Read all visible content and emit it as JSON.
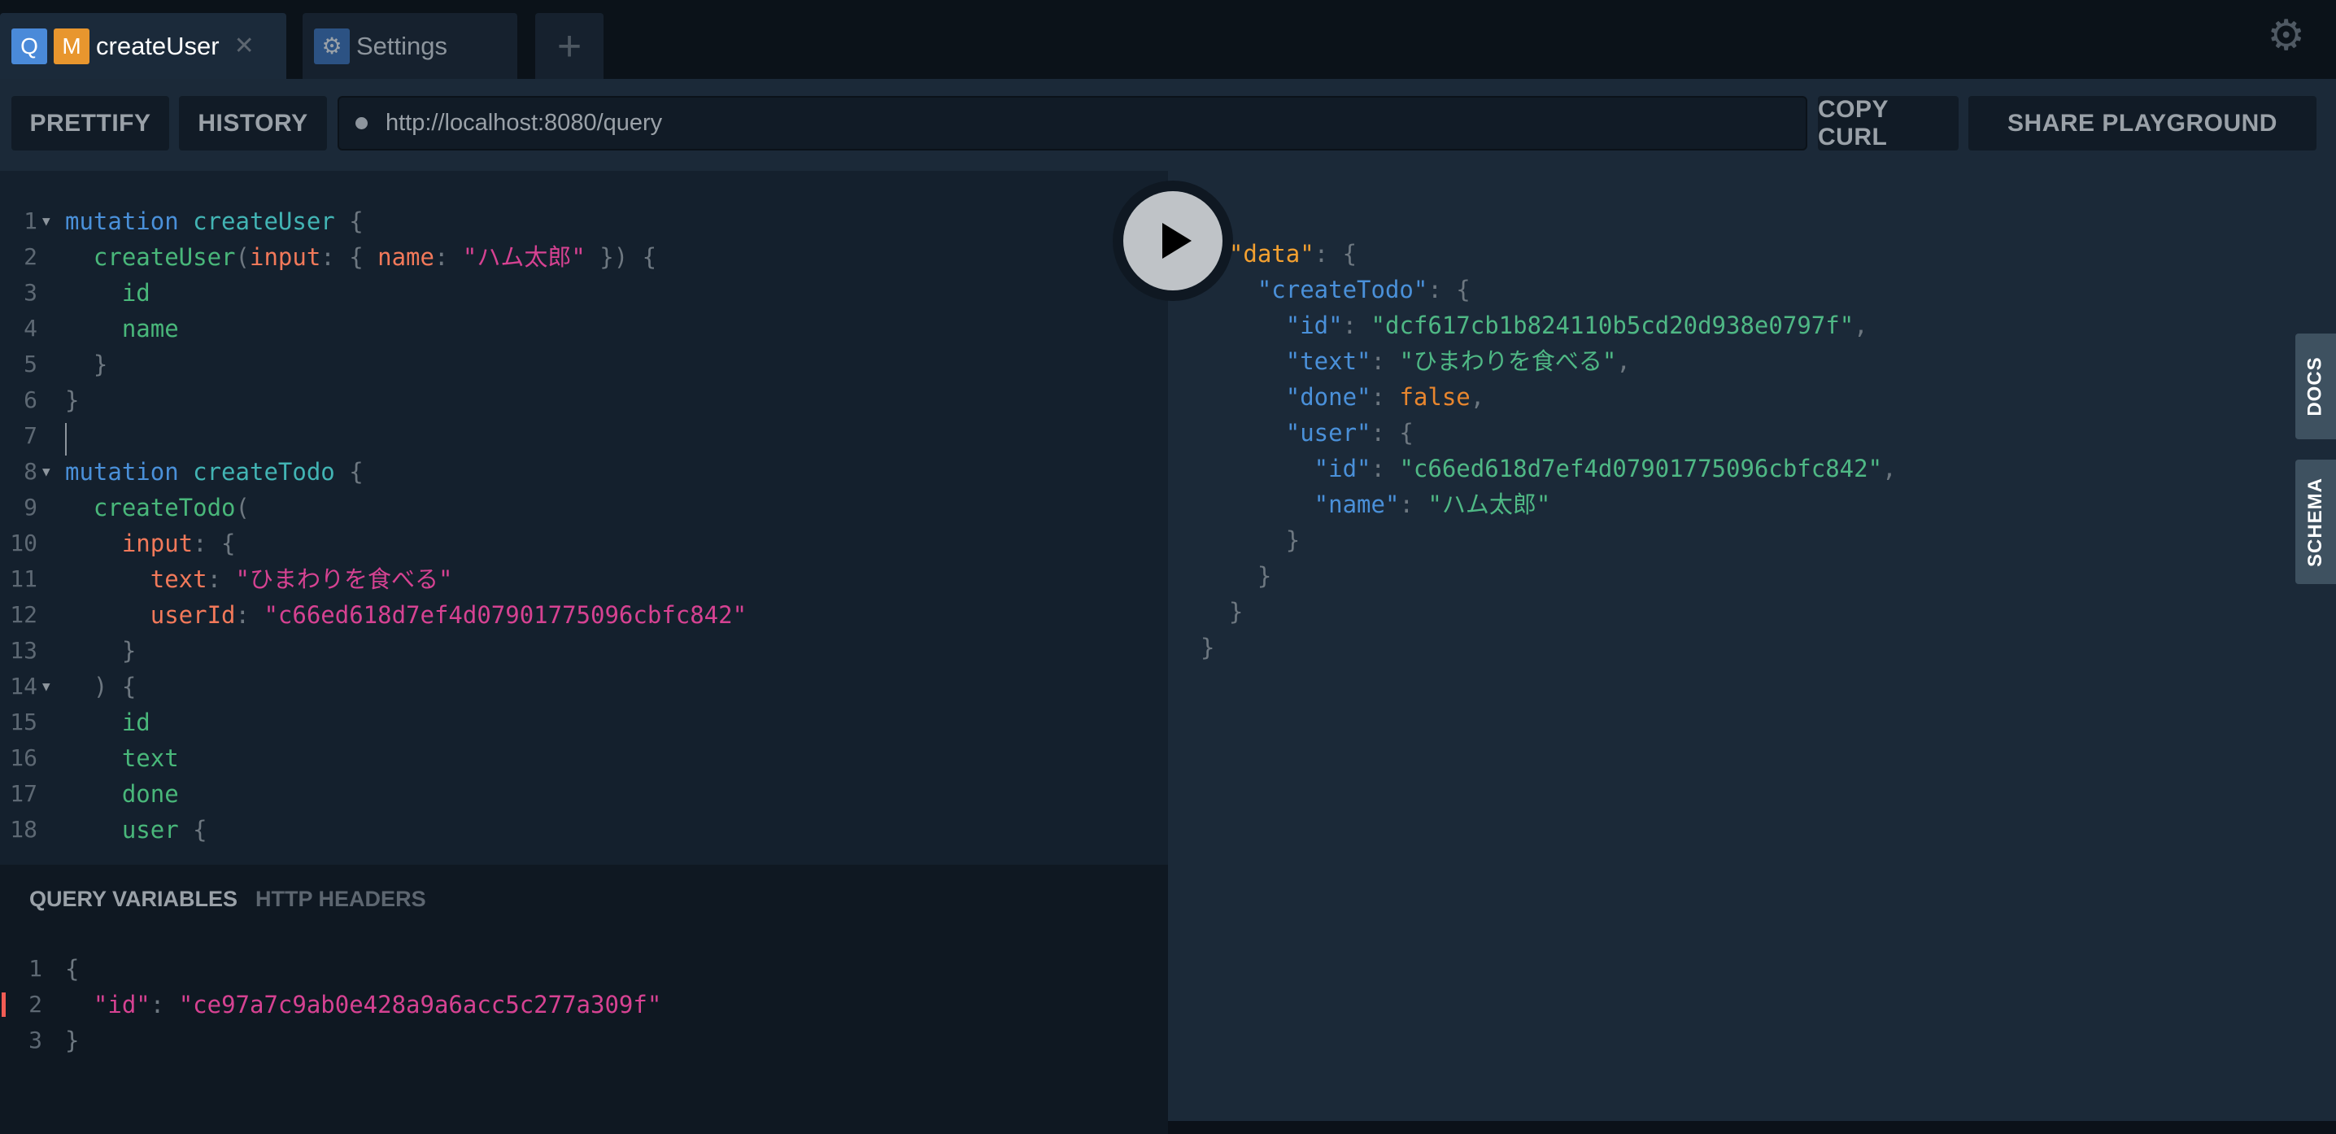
{
  "tabs": [
    {
      "label": "createUser",
      "badges": [
        "Q",
        "M"
      ],
      "active": true
    },
    {
      "label": "Settings",
      "icon": "gear-icon"
    },
    {
      "label": "+",
      "icon": "plus-icon"
    }
  ],
  "colors": {
    "query_badge": "#4a8ad9",
    "mutation_badge": "#e8962e",
    "settings_badge": "#2c5283",
    "accent_error": "#f25c54"
  },
  "toolbar": {
    "prettify": "PRETTIFY",
    "history": "HISTORY",
    "url": "http://localhost:8080/query",
    "copy_curl": "COPY CURL",
    "share": "SHARE PLAYGROUND"
  },
  "side_tabs": {
    "docs": "DOCS",
    "schema": "SCHEMA"
  },
  "bottom_tabs": {
    "variables": "QUERY VARIABLES",
    "headers": "HTTP HEADERS"
  },
  "editor_lines": [
    {
      "n": "1",
      "fold": true,
      "tokens": [
        [
          "keyword",
          "mutation "
        ],
        [
          "def",
          "createUser "
        ],
        [
          "punct",
          "{"
        ]
      ]
    },
    {
      "n": "2",
      "tokens": [
        [
          "field",
          "  createUser"
        ],
        [
          "punct",
          "("
        ],
        [
          "attr",
          "input"
        ],
        [
          "punct",
          ": { "
        ],
        [
          "attr",
          "name"
        ],
        [
          "punct",
          ": "
        ],
        [
          "string",
          "\"ハム太郎\""
        ],
        [
          "punct",
          " }) {"
        ]
      ]
    },
    {
      "n": "3",
      "tokens": [
        [
          "field",
          "    id"
        ]
      ]
    },
    {
      "n": "4",
      "tokens": [
        [
          "field",
          "    name"
        ]
      ]
    },
    {
      "n": "5",
      "tokens": [
        [
          "punct",
          "  }"
        ]
      ]
    },
    {
      "n": "6",
      "tokens": [
        [
          "punct",
          "}"
        ]
      ]
    },
    {
      "n": "7",
      "cursor": true,
      "tokens": []
    },
    {
      "n": "8",
      "fold": true,
      "tokens": [
        [
          "keyword",
          "mutation "
        ],
        [
          "def",
          "createTodo "
        ],
        [
          "punct",
          "{"
        ]
      ]
    },
    {
      "n": "9",
      "tokens": [
        [
          "field",
          "  createTodo"
        ],
        [
          "punct",
          "("
        ]
      ]
    },
    {
      "n": "10",
      "tokens": [
        [
          "attr",
          "    input"
        ],
        [
          "punct",
          ": {"
        ]
      ]
    },
    {
      "n": "11",
      "tokens": [
        [
          "attr",
          "      text"
        ],
        [
          "punct",
          ": "
        ],
        [
          "string",
          "\"ひまわりを食べる\""
        ]
      ]
    },
    {
      "n": "12",
      "tokens": [
        [
          "attr",
          "      userId"
        ],
        [
          "punct",
          ": "
        ],
        [
          "string",
          "\"c66ed618d7ef4d07901775096cbfc842\""
        ]
      ]
    },
    {
      "n": "13",
      "tokens": [
        [
          "punct",
          "    }"
        ]
      ]
    },
    {
      "n": "14",
      "fold": true,
      "tokens": [
        [
          "punct",
          "  ) {"
        ]
      ]
    },
    {
      "n": "15",
      "tokens": [
        [
          "field",
          "    id"
        ]
      ]
    },
    {
      "n": "16",
      "tokens": [
        [
          "field",
          "    text"
        ]
      ]
    },
    {
      "n": "17",
      "tokens": [
        [
          "field",
          "    done"
        ]
      ]
    },
    {
      "n": "18",
      "tokens": [
        [
          "field",
          "    user "
        ],
        [
          "punct",
          "{"
        ]
      ]
    }
  ],
  "result_lines": [
    {
      "fold": true,
      "tokens": [
        [
          "punct",
          "{"
        ]
      ]
    },
    {
      "fold": true,
      "tokens": [
        [
          "jtop",
          "  \"data\""
        ],
        [
          "punct",
          ": {"
        ]
      ]
    },
    {
      "fold": true,
      "tokens": [
        [
          "jkey",
          "    \"createTodo\""
        ],
        [
          "punct",
          ": {"
        ]
      ]
    },
    {
      "tokens": [
        [
          "jkey",
          "      \"id\""
        ],
        [
          "punct",
          ": "
        ],
        [
          "jstr",
          "\"dcf617cb1b824110b5cd20d938e0797f\""
        ],
        [
          "punct",
          ","
        ]
      ]
    },
    {
      "tokens": [
        [
          "jkey",
          "      \"text\""
        ],
        [
          "punct",
          ": "
        ],
        [
          "jstr",
          "\"ひまわりを食べる\""
        ],
        [
          "punct",
          ","
        ]
      ]
    },
    {
      "tokens": [
        [
          "jkey",
          "      \"done\""
        ],
        [
          "punct",
          ": "
        ],
        [
          "jbool",
          "false"
        ],
        [
          "punct",
          ","
        ]
      ]
    },
    {
      "tokens": [
        [
          "jkey",
          "      \"user\""
        ],
        [
          "punct",
          ": {"
        ]
      ]
    },
    {
      "tokens": [
        [
          "jkey",
          "        \"id\""
        ],
        [
          "punct",
          ": "
        ],
        [
          "jstr",
          "\"c66ed618d7ef4d07901775096cbfc842\""
        ],
        [
          "punct",
          ","
        ]
      ]
    },
    {
      "tokens": [
        [
          "jkey",
          "        \"name\""
        ],
        [
          "punct",
          ": "
        ],
        [
          "jstr",
          "\"ハム太郎\""
        ]
      ]
    },
    {
      "tokens": [
        [
          "punct",
          "      }"
        ]
      ]
    },
    {
      "tokens": [
        [
          "punct",
          "    }"
        ]
      ]
    },
    {
      "tokens": [
        [
          "punct",
          "  }"
        ]
      ]
    },
    {
      "tokens": [
        [
          "punct",
          "}"
        ]
      ]
    }
  ],
  "variables_lines": [
    {
      "n": "1",
      "tokens": [
        [
          "punct",
          "{"
        ]
      ]
    },
    {
      "n": "2",
      "error": true,
      "tokens": [
        [
          "string",
          "  \"id\""
        ],
        [
          "punct",
          ": "
        ],
        [
          "string",
          "\"ce97a7c9ab0e428a9a6acc5c277a309f\""
        ]
      ]
    },
    {
      "n": "3",
      "tokens": [
        [
          "punct",
          "}"
        ]
      ]
    }
  ]
}
